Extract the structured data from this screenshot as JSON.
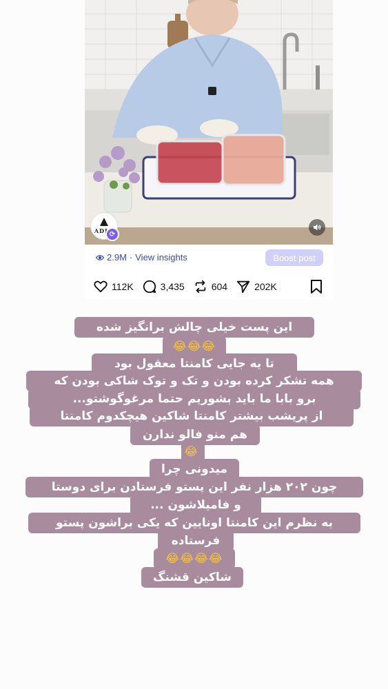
{
  "post": {
    "brand_logo_text": "ADIN",
    "stats": {
      "views": "2.9M",
      "insights_link": "View insights",
      "boost_label": "Boost post"
    },
    "actions": {
      "likes": "112K",
      "comments": "3,435",
      "reposts": "604",
      "shares": "202K"
    }
  },
  "caption_lines": [
    "این پست خیلی چالش برانگیز شده",
    "😂😂😂",
    "تا یه جایی کامنتا معقول بود",
    "همه تشکر کرده بودن و تک و توک شاکی بودن که",
    "برو بابا ما باید بشوریم حتما مرغوگوشتو...",
    "از پریشب بیشتر کامنتا شاکین هیچکدوم کامنتا",
    "هم منو فالو ندارن",
    "😂",
    "میدونی چرا",
    "چون ۲۰۲ هزار نفر این پستو فرستادن برای دوستا",
    "و فامیلاشون ...",
    "به نظرم این کامنتا اونایین که یکی براشون پستو",
    "فرستاده",
    "😂😂😂😂",
    "شاکین قشنگ"
  ],
  "colors": {
    "caption_bubble": "#a88b9c",
    "link_blue": "#3b4ba8",
    "boost_button": "#cfd1fb",
    "repost_badge": "#7b5cf5"
  }
}
